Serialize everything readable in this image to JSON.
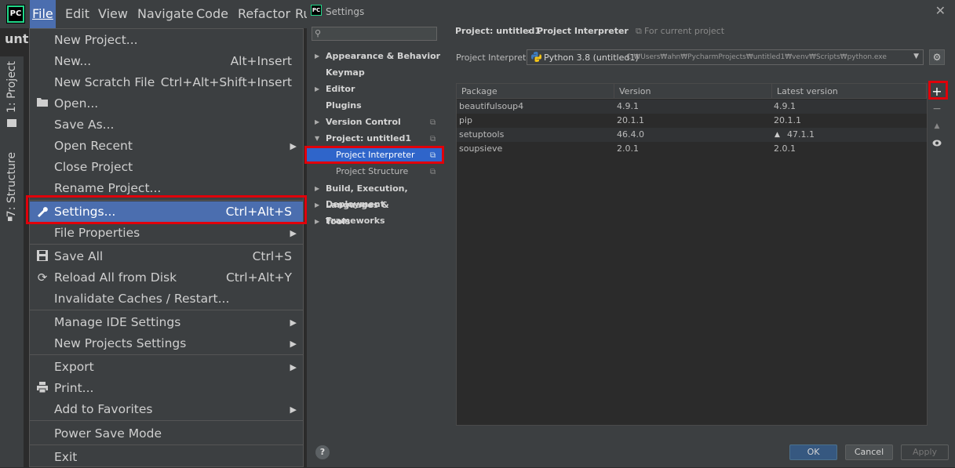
{
  "menubar": {
    "logo": "PC",
    "items": [
      "File",
      "Edit",
      "View",
      "Navigate",
      "Code",
      "Refactor",
      "Ru"
    ]
  },
  "project_panel": {
    "title": "unt",
    "tab_project": "1: Project",
    "tab_structure": "7: Structure"
  },
  "file_menu": {
    "new_project": "New Project...",
    "new": "New...",
    "new_shortcut": "Alt+Insert",
    "new_scratch": "New Scratch File",
    "new_scratch_shortcut": "Ctrl+Alt+Shift+Insert",
    "open": "Open...",
    "save_as": "Save As...",
    "open_recent": "Open Recent",
    "close_project": "Close Project",
    "rename_project": "Rename Project...",
    "settings": "Settings...",
    "settings_shortcut": "Ctrl+Alt+S",
    "file_properties": "File Properties",
    "save_all": "Save All",
    "save_all_shortcut": "Ctrl+S",
    "reload": "Reload All from Disk",
    "reload_shortcut": "Ctrl+Alt+Y",
    "invalidate": "Invalidate Caches / Restart...",
    "manage_ide": "Manage IDE Settings",
    "new_projects_settings": "New Projects Settings",
    "export": "Export",
    "print": "Print...",
    "add_favorites": "Add to Favorites",
    "power_save": "Power Save Mode",
    "exit": "Exit"
  },
  "settings": {
    "title": "Settings",
    "search_placeholder": "",
    "tree": {
      "appearance": "Appearance & Behavior",
      "keymap": "Keymap",
      "editor": "Editor",
      "plugins": "Plugins",
      "version_control": "Version Control",
      "project": "Project: untitled1",
      "project_interpreter": "Project Interpreter",
      "project_structure": "Project Structure",
      "build": "Build, Execution, Deployment",
      "languages": "Languages & Frameworks",
      "tools": "Tools"
    },
    "breadcrumb": {
      "project": "Project: untitled1",
      "sep": "›",
      "page": "Project Interpreter",
      "scope": "For current project"
    },
    "interpreter_label": "Project Interpreter:",
    "interpreter_name": "Python 3.8 (untitled1)",
    "interpreter_path": "C:₩Users₩ahn₩PycharmProjects₩untitled1₩venv₩Scripts₩python.exe",
    "table": {
      "headers": [
        "Package",
        "Version",
        "Latest version"
      ],
      "rows": [
        {
          "package": "beautifulsoup4",
          "version": "4.9.1",
          "latest": "4.9.1",
          "upgrade": ""
        },
        {
          "package": "pip",
          "version": "20.1.1",
          "latest": "20.1.1",
          "upgrade": ""
        },
        {
          "package": "setuptools",
          "version": "46.4.0",
          "latest": "47.1.1",
          "upgrade": "▲"
        },
        {
          "package": "soupsieve",
          "version": "2.0.1",
          "latest": "2.0.1",
          "upgrade": ""
        }
      ]
    },
    "buttons": {
      "ok": "OK",
      "cancel": "Cancel",
      "apply": "Apply",
      "help": "?"
    }
  },
  "colors": {
    "highlight": "#4b6eaf",
    "tree_selection": "#2f65ca",
    "annotation": "#e0000a"
  }
}
